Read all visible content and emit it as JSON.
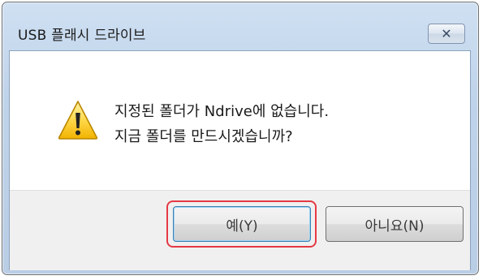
{
  "dialog": {
    "title": "USB 플래시 드라이브",
    "close_symbol": "✕",
    "message_line1": "지정된 폴더가 Ndrive에 없습니다.",
    "message_line2": "지금 폴더를 만드시겠습니까?",
    "icon": "warning-icon",
    "buttons": {
      "yes_label": "예(Y)",
      "no_label": "아니요(N)"
    },
    "highlight_color": "#e53945"
  }
}
